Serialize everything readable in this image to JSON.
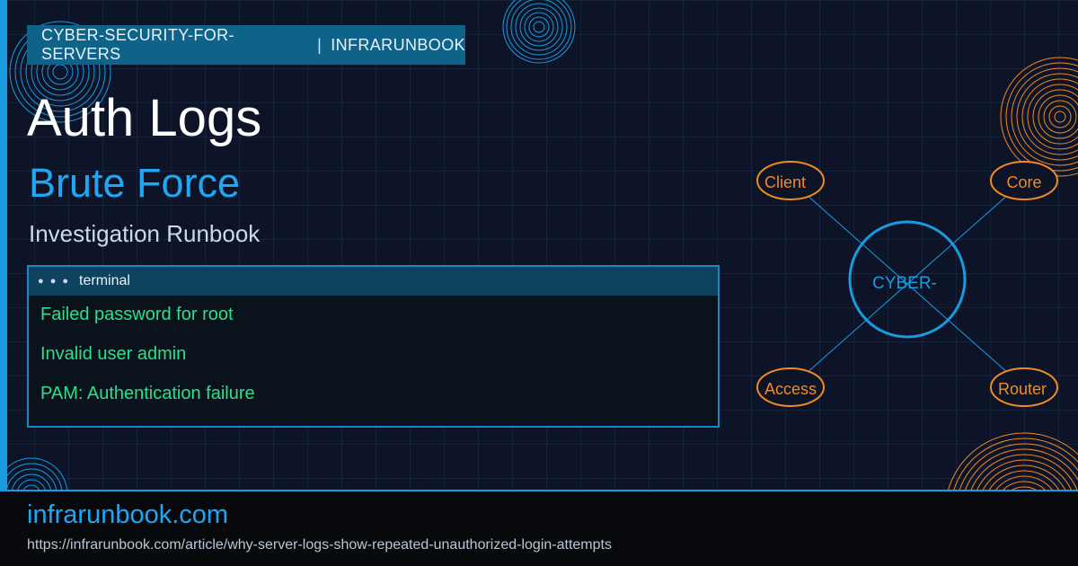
{
  "header": {
    "category": "CYBER-SECURITY-FOR-SERVERS",
    "separator": "|",
    "brand": "INFRARUNBOOK"
  },
  "title": "Auth Logs",
  "subtitle": "Brute Force",
  "caption": "Investigation Runbook",
  "terminal": {
    "dots": "● ● ●",
    "title": "terminal",
    "lines": [
      "Failed password for root",
      "Invalid user admin",
      "PAM: Authentication failure"
    ]
  },
  "diagram": {
    "center": "CYBER-",
    "nodes": [
      "Client",
      "Core",
      "Access",
      "Router"
    ]
  },
  "footer": {
    "site": "infrarunbook.com",
    "url": "https://infrarunbook.com/article/why-server-logs-show-repeated-unauthorized-login-attempts"
  },
  "colors": {
    "accent": "#1a9be0",
    "orange": "#f08a24",
    "terminal_green": "#29e08c"
  }
}
